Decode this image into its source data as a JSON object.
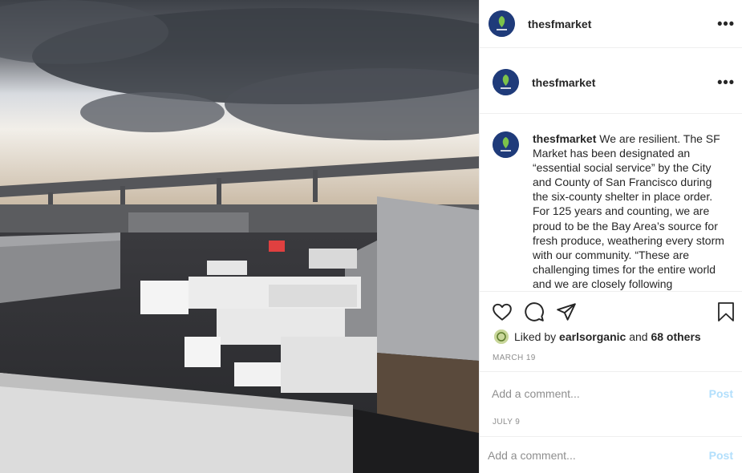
{
  "account": {
    "username": "thesfmarket"
  },
  "post": {
    "username": "thesfmarket",
    "caption": "We are resilient. The SF Market has been designated an “essential social service” by the City and County of San Francisco during the six-county shelter in place order. For 125 years and counting, we are proud to be the Bay Area’s source for fresh produce, weathering every storm with our community. “These are challenging times for the entire world and we are closely following",
    "liked_prefix": "Liked by",
    "liked_user": "earlsorganic",
    "liked_and": "and",
    "liked_others": "68 others",
    "date": "MARCH 19"
  },
  "comment_box": {
    "placeholder": "Add a comment...",
    "post_label": "Post"
  },
  "comment_box_2": {
    "placeholder": "Add a comment...",
    "post_label": "Post"
  },
  "second_date": "JULY 9",
  "icons": {
    "more": "more-horizontal-icon",
    "like": "heart-icon",
    "comment": "comment-bubble-icon",
    "share": "paper-plane-icon",
    "save": "bookmark-icon"
  },
  "colors": {
    "link_disabled": "#b2dffc",
    "muted": "#8e8e8e",
    "text": "#262626"
  }
}
